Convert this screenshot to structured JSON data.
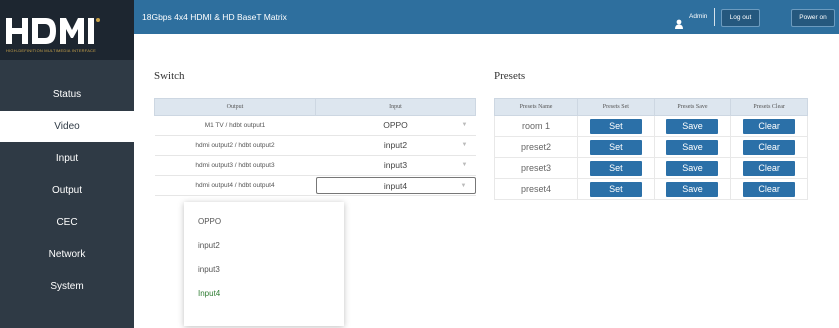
{
  "logo": {
    "text": "HDMI",
    "tagline": "HIGH-DEFINITION MULTIMEDIA INTERFACE"
  },
  "sidebar": {
    "items": [
      {
        "label": "Status"
      },
      {
        "label": "Video"
      },
      {
        "label": "Input"
      },
      {
        "label": "Output"
      },
      {
        "label": "CEC"
      },
      {
        "label": "Network"
      },
      {
        "label": "System"
      }
    ]
  },
  "header": {
    "title": "18Gbps 4x4 HDMI & HD BaseT Matrix",
    "user": "Admin",
    "logout": "Log out",
    "power": "Power on"
  },
  "switch": {
    "title": "Switch",
    "col_output": "Output",
    "col_input": "Input",
    "rows": [
      {
        "output": "M1 TV / hdbt output1",
        "input": "OPPO"
      },
      {
        "output": "hdmi output2 / hdbt output2",
        "input": "input2"
      },
      {
        "output": "hdmi output3 / hdbt output3",
        "input": "input3"
      },
      {
        "output": "hdmi output4 / hdbt output4",
        "input": "input4"
      }
    ],
    "dropdown": {
      "options": [
        "OPPO",
        "input2",
        "input3",
        "Input4"
      ],
      "selected_index": 3
    }
  },
  "presets": {
    "title": "Presets",
    "col_name": "Presets Name",
    "col_set": "Presets Set",
    "col_save": "Presets Save",
    "col_clear": "Presets Clear",
    "rows": [
      {
        "name": "room 1",
        "set": "Set",
        "save": "Save",
        "clear": "Clear"
      },
      {
        "name": "preset2",
        "set": "Set",
        "save": "Save",
        "clear": "Clear"
      },
      {
        "name": "preset3",
        "set": "Set",
        "save": "Save",
        "clear": "Clear"
      },
      {
        "name": "preset4",
        "set": "Set",
        "save": "Save",
        "clear": "Clear"
      }
    ]
  },
  "colors": {
    "sidebar": "#2f3a45",
    "topbar": "#2e6f9e",
    "button": "#2b70a8",
    "active_option": "#2e7d32"
  },
  "icons": {
    "user": "user-icon",
    "dropdown_arrow": "chevron-down-icon"
  }
}
